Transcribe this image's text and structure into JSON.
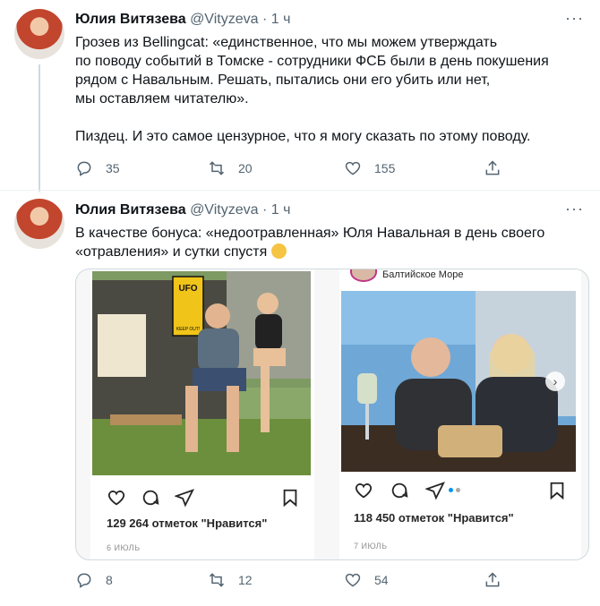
{
  "tweets": [
    {
      "name": "Юлия Витязева",
      "handle": "@Vityzeva",
      "dot": "·",
      "time": "1 ч",
      "more": "···",
      "lines": [
        "Грозев из Bellingcat: «единственное, что мы можем утверждать",
        "по поводу событий в Томске - сотрудники ФСБ были в день покушения",
        "рядом с Навальным. Решать, пытались они его убить или нет,",
        "мы оставляем читателю».",
        "",
        "Пиздец. И это самое цензурное, что я могу сказать по этому поводу."
      ],
      "replies": "35",
      "retweets": "20",
      "likes": "155"
    },
    {
      "name": "Юлия Витязева",
      "handle": "@Vityzeva",
      "dot": "·",
      "time": "1 ч",
      "more": "···",
      "lines": [
        "В качестве бонуса: «недоотравленная» Юля Навальная в день своего",
        "«отравления» и сутки спустя"
      ],
      "replies": "8",
      "retweets": "12",
      "likes": "54",
      "media": {
        "left_post": {
          "sign_text": "UFO",
          "sign_sub": "KEEP OUT!",
          "likes": "129 264 отметок \"Нравится\"",
          "date": "6 ИЮЛЬ"
        },
        "right_post": {
          "location": "Балтийское Море",
          "likes": "118 450 отметок \"Нравится\"",
          "date": "7 ИЮЛЬ"
        }
      }
    }
  ],
  "icons": {
    "reply": "reply-icon",
    "retweet": "retweet-icon",
    "like": "heart-icon",
    "share": "share-icon"
  },
  "colors": {
    "text": "#0f1419",
    "secondary": "#536471",
    "border": "#cfd9de"
  }
}
